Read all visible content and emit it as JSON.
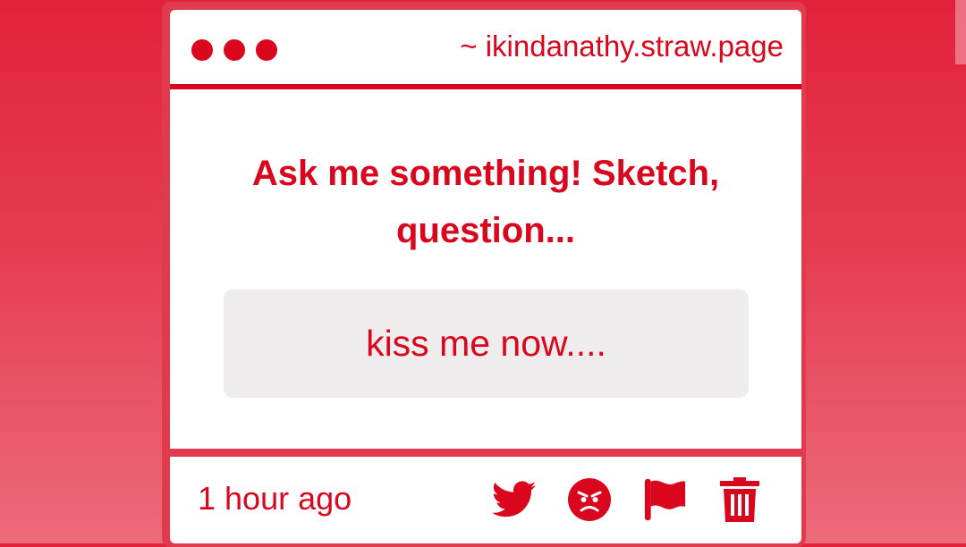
{
  "window": {
    "url": "~ ikindanathy.straw.page",
    "dots": [
      "dot-1",
      "dot-2",
      "dot-3"
    ]
  },
  "card": {
    "prompt": "Ask me something! Sketch, question...",
    "answer": "kiss me now...."
  },
  "footer": {
    "timestamp": "1 hour ago",
    "actions": [
      {
        "name": "share-twitter-button",
        "icon": "twitter-icon"
      },
      {
        "name": "react-angry-button",
        "icon": "angry-face-icon"
      },
      {
        "name": "report-flag-button",
        "icon": "flag-icon"
      },
      {
        "name": "delete-button",
        "icon": "trash-icon"
      }
    ]
  },
  "colors": {
    "accent": "#d9061d",
    "background_top": "#e2223b",
    "background_bottom": "#ec6b7b",
    "answer_bg": "#eeecec"
  }
}
